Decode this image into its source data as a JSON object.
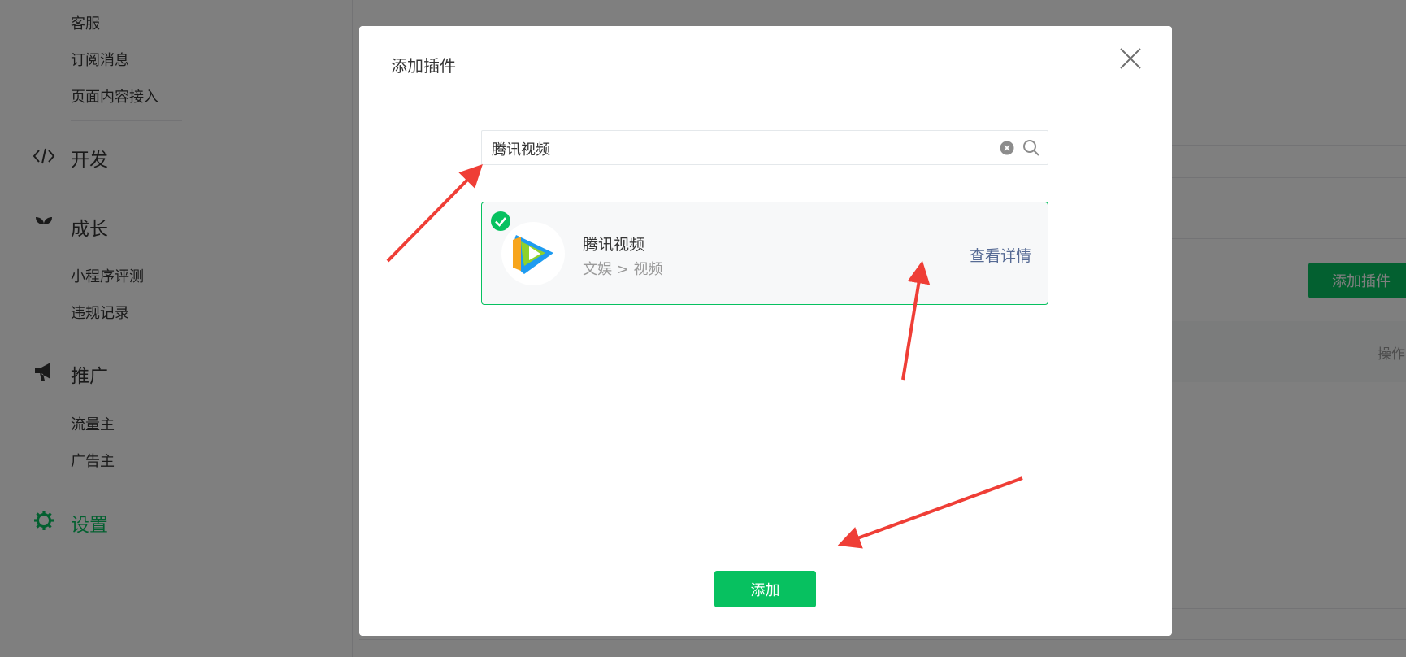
{
  "sidebar": {
    "items": {
      "customer_service": "客服",
      "subscribe_messages": "订阅消息",
      "page_content_access": "页面内容接入",
      "develop": "开发",
      "growth": "成长",
      "miniprogram_review": "小程序评测",
      "violation_records": "违规记录",
      "promotion": "推广",
      "traffic_owner": "流量主",
      "advertiser": "广告主",
      "settings": "设置"
    },
    "icons": {
      "develop": "code-icon",
      "growth": "sprout-icon",
      "promotion": "megaphone-icon",
      "settings": "gear-icon"
    },
    "active_item": "settings"
  },
  "background": {
    "add_plugin_button": "添加插件",
    "table_header_operation": "操作"
  },
  "dialog": {
    "title": "添加插件",
    "search": {
      "value": "腾讯视频"
    },
    "result": {
      "name": "腾讯视频",
      "category": "文娱 > 视频",
      "detail_link": "查看详情",
      "selected": true,
      "logo": "tencent-video-logo"
    },
    "add_button": "添加"
  },
  "colors": {
    "brand_green": "#07c160",
    "link_blue": "#576b95",
    "annotation_red": "#ef3e36",
    "overlay": "rgba(0,0,0,0.5)"
  }
}
